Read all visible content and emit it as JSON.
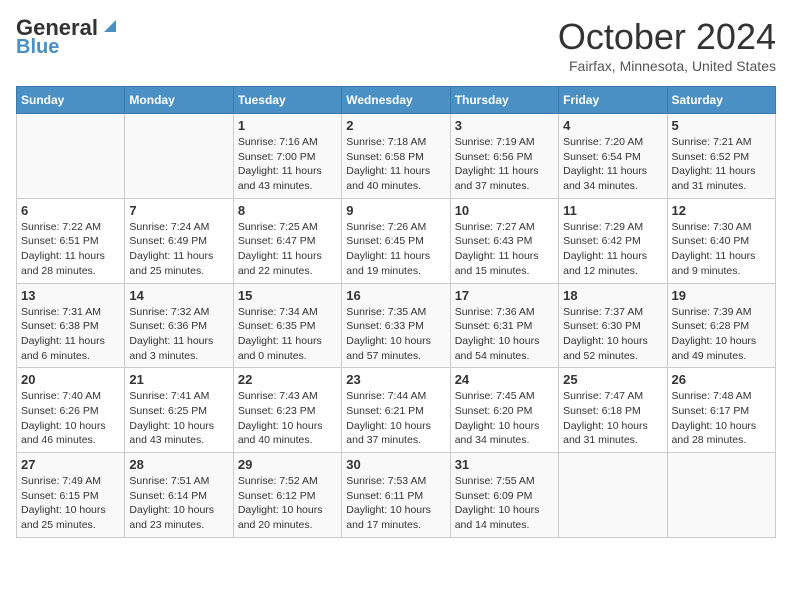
{
  "header": {
    "logo_line1": "General",
    "logo_line2": "Blue",
    "month_title": "October 2024",
    "location": "Fairfax, Minnesota, United States"
  },
  "days_of_week": [
    "Sunday",
    "Monday",
    "Tuesday",
    "Wednesday",
    "Thursday",
    "Friday",
    "Saturday"
  ],
  "weeks": [
    [
      {
        "day": "",
        "sunrise": "",
        "sunset": "",
        "daylight": ""
      },
      {
        "day": "",
        "sunrise": "",
        "sunset": "",
        "daylight": ""
      },
      {
        "day": "1",
        "sunrise": "Sunrise: 7:16 AM",
        "sunset": "Sunset: 7:00 PM",
        "daylight": "Daylight: 11 hours and 43 minutes."
      },
      {
        "day": "2",
        "sunrise": "Sunrise: 7:18 AM",
        "sunset": "Sunset: 6:58 PM",
        "daylight": "Daylight: 11 hours and 40 minutes."
      },
      {
        "day": "3",
        "sunrise": "Sunrise: 7:19 AM",
        "sunset": "Sunset: 6:56 PM",
        "daylight": "Daylight: 11 hours and 37 minutes."
      },
      {
        "day": "4",
        "sunrise": "Sunrise: 7:20 AM",
        "sunset": "Sunset: 6:54 PM",
        "daylight": "Daylight: 11 hours and 34 minutes."
      },
      {
        "day": "5",
        "sunrise": "Sunrise: 7:21 AM",
        "sunset": "Sunset: 6:52 PM",
        "daylight": "Daylight: 11 hours and 31 minutes."
      }
    ],
    [
      {
        "day": "6",
        "sunrise": "Sunrise: 7:22 AM",
        "sunset": "Sunset: 6:51 PM",
        "daylight": "Daylight: 11 hours and 28 minutes."
      },
      {
        "day": "7",
        "sunrise": "Sunrise: 7:24 AM",
        "sunset": "Sunset: 6:49 PM",
        "daylight": "Daylight: 11 hours and 25 minutes."
      },
      {
        "day": "8",
        "sunrise": "Sunrise: 7:25 AM",
        "sunset": "Sunset: 6:47 PM",
        "daylight": "Daylight: 11 hours and 22 minutes."
      },
      {
        "day": "9",
        "sunrise": "Sunrise: 7:26 AM",
        "sunset": "Sunset: 6:45 PM",
        "daylight": "Daylight: 11 hours and 19 minutes."
      },
      {
        "day": "10",
        "sunrise": "Sunrise: 7:27 AM",
        "sunset": "Sunset: 6:43 PM",
        "daylight": "Daylight: 11 hours and 15 minutes."
      },
      {
        "day": "11",
        "sunrise": "Sunrise: 7:29 AM",
        "sunset": "Sunset: 6:42 PM",
        "daylight": "Daylight: 11 hours and 12 minutes."
      },
      {
        "day": "12",
        "sunrise": "Sunrise: 7:30 AM",
        "sunset": "Sunset: 6:40 PM",
        "daylight": "Daylight: 11 hours and 9 minutes."
      }
    ],
    [
      {
        "day": "13",
        "sunrise": "Sunrise: 7:31 AM",
        "sunset": "Sunset: 6:38 PM",
        "daylight": "Daylight: 11 hours and 6 minutes."
      },
      {
        "day": "14",
        "sunrise": "Sunrise: 7:32 AM",
        "sunset": "Sunset: 6:36 PM",
        "daylight": "Daylight: 11 hours and 3 minutes."
      },
      {
        "day": "15",
        "sunrise": "Sunrise: 7:34 AM",
        "sunset": "Sunset: 6:35 PM",
        "daylight": "Daylight: 11 hours and 0 minutes."
      },
      {
        "day": "16",
        "sunrise": "Sunrise: 7:35 AM",
        "sunset": "Sunset: 6:33 PM",
        "daylight": "Daylight: 10 hours and 57 minutes."
      },
      {
        "day": "17",
        "sunrise": "Sunrise: 7:36 AM",
        "sunset": "Sunset: 6:31 PM",
        "daylight": "Daylight: 10 hours and 54 minutes."
      },
      {
        "day": "18",
        "sunrise": "Sunrise: 7:37 AM",
        "sunset": "Sunset: 6:30 PM",
        "daylight": "Daylight: 10 hours and 52 minutes."
      },
      {
        "day": "19",
        "sunrise": "Sunrise: 7:39 AM",
        "sunset": "Sunset: 6:28 PM",
        "daylight": "Daylight: 10 hours and 49 minutes."
      }
    ],
    [
      {
        "day": "20",
        "sunrise": "Sunrise: 7:40 AM",
        "sunset": "Sunset: 6:26 PM",
        "daylight": "Daylight: 10 hours and 46 minutes."
      },
      {
        "day": "21",
        "sunrise": "Sunrise: 7:41 AM",
        "sunset": "Sunset: 6:25 PM",
        "daylight": "Daylight: 10 hours and 43 minutes."
      },
      {
        "day": "22",
        "sunrise": "Sunrise: 7:43 AM",
        "sunset": "Sunset: 6:23 PM",
        "daylight": "Daylight: 10 hours and 40 minutes."
      },
      {
        "day": "23",
        "sunrise": "Sunrise: 7:44 AM",
        "sunset": "Sunset: 6:21 PM",
        "daylight": "Daylight: 10 hours and 37 minutes."
      },
      {
        "day": "24",
        "sunrise": "Sunrise: 7:45 AM",
        "sunset": "Sunset: 6:20 PM",
        "daylight": "Daylight: 10 hours and 34 minutes."
      },
      {
        "day": "25",
        "sunrise": "Sunrise: 7:47 AM",
        "sunset": "Sunset: 6:18 PM",
        "daylight": "Daylight: 10 hours and 31 minutes."
      },
      {
        "day": "26",
        "sunrise": "Sunrise: 7:48 AM",
        "sunset": "Sunset: 6:17 PM",
        "daylight": "Daylight: 10 hours and 28 minutes."
      }
    ],
    [
      {
        "day": "27",
        "sunrise": "Sunrise: 7:49 AM",
        "sunset": "Sunset: 6:15 PM",
        "daylight": "Daylight: 10 hours and 25 minutes."
      },
      {
        "day": "28",
        "sunrise": "Sunrise: 7:51 AM",
        "sunset": "Sunset: 6:14 PM",
        "daylight": "Daylight: 10 hours and 23 minutes."
      },
      {
        "day": "29",
        "sunrise": "Sunrise: 7:52 AM",
        "sunset": "Sunset: 6:12 PM",
        "daylight": "Daylight: 10 hours and 20 minutes."
      },
      {
        "day": "30",
        "sunrise": "Sunrise: 7:53 AM",
        "sunset": "Sunset: 6:11 PM",
        "daylight": "Daylight: 10 hours and 17 minutes."
      },
      {
        "day": "31",
        "sunrise": "Sunrise: 7:55 AM",
        "sunset": "Sunset: 6:09 PM",
        "daylight": "Daylight: 10 hours and 14 minutes."
      },
      {
        "day": "",
        "sunrise": "",
        "sunset": "",
        "daylight": ""
      },
      {
        "day": "",
        "sunrise": "",
        "sunset": "",
        "daylight": ""
      }
    ]
  ]
}
